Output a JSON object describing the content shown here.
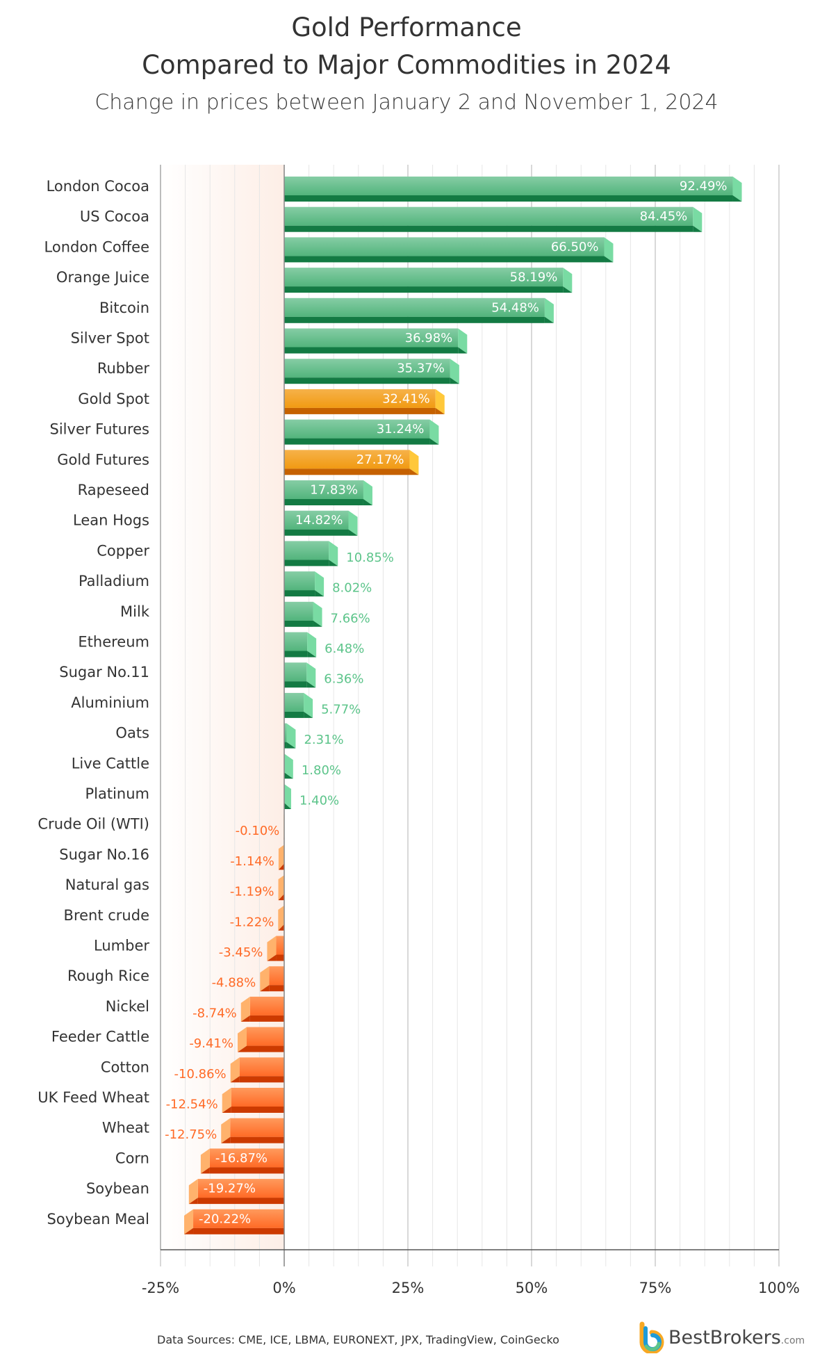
{
  "colors": {
    "green_top": "#86cda5",
    "green_mid": "#52b47c",
    "green_dark": "#137a43",
    "green_side": "#79dba3",
    "green_label": "#5cc48a",
    "gold_top": "#f6b24a",
    "gold_mid": "#f19a12",
    "gold_dark": "#c56100",
    "gold_side": "#ffc83a",
    "red_top": "#ff9a5c",
    "red_mid": "#ff6a26",
    "red_dark": "#cc3a00",
    "red_side": "#ffb26c",
    "red_label": "#ff6a26",
    "grid": "#e6e6e6",
    "axis": "#555555",
    "neg_zone": "#fdeee6"
  },
  "footer": {
    "sources": "Data Sources: CME, ICE, LBMA, EURONEXT, JPX, TradingView, CoinGecko",
    "logo_text": "BestBrokers",
    "logo_suffix": ".com"
  },
  "chart_data": {
    "type": "bar",
    "orientation": "horizontal",
    "title": "Gold Performance",
    "title_line2": "Compared to Major Commodities in 2024",
    "subtitle": "Change in prices between January 2 and November 1, 2024",
    "xlabel": "",
    "ylabel": "",
    "xlim": [
      -25,
      100
    ],
    "xticks": [
      -25,
      0,
      25,
      50,
      75,
      100
    ],
    "xtick_labels": [
      "-25%",
      "0%",
      "25%",
      "50%",
      "75%",
      "100%"
    ],
    "grid": true,
    "legend": "none",
    "categories": [
      "London Cocoa",
      "US Cocoa",
      "London Coffee",
      "Orange Juice",
      "Bitcoin",
      "Silver Spot",
      "Rubber",
      "Gold Spot",
      "Silver Futures",
      "Gold Futures",
      "Rapeseed",
      "Lean Hogs",
      "Copper",
      "Palladium",
      "Milk",
      "Ethereum",
      "Sugar No.11",
      "Aluminium",
      "Oats",
      "Live Cattle",
      "Platinum",
      "Crude Oil (WTI)",
      "Sugar No.16",
      "Natural gas",
      "Brent crude",
      "Lumber",
      "Rough Rice",
      "Nickel",
      "Feeder Cattle",
      "Cotton",
      "UK Feed Wheat",
      "Wheat",
      "Corn",
      "Soybean",
      "Soybean Meal"
    ],
    "values": [
      92.49,
      84.45,
      66.5,
      58.19,
      54.48,
      36.98,
      35.37,
      32.41,
      31.24,
      27.17,
      17.83,
      14.82,
      10.85,
      8.02,
      7.66,
      6.48,
      6.36,
      5.77,
      2.31,
      1.8,
      1.4,
      -0.1,
      -1.14,
      -1.19,
      -1.22,
      -3.45,
      -4.88,
      -8.74,
      -9.41,
      -10.86,
      -12.54,
      -12.75,
      -16.87,
      -19.27,
      -20.22
    ],
    "data_labels": [
      "92.49%",
      "84.45%",
      "66.50%",
      "58.19%",
      "54.48%",
      "36.98%",
      "35.37%",
      "32.41%",
      "31.24%",
      "27.17%",
      "17.83%",
      "14.82%",
      "10.85%",
      "8.02%",
      "7.66%",
      "6.48%",
      "6.36%",
      "5.77%",
      "2.31%",
      "1.80%",
      "1.40%",
      "-0.10%",
      "-1.14%",
      "-1.19%",
      "-1.22%",
      "-3.45%",
      "-4.88%",
      "-8.74%",
      "-9.41%",
      "-10.86%",
      "-12.54%",
      "-12.75%",
      "-16.87%",
      "-19.27%",
      "-20.22%"
    ],
    "highlighted": [
      "Gold Spot",
      "Gold Futures"
    ]
  }
}
